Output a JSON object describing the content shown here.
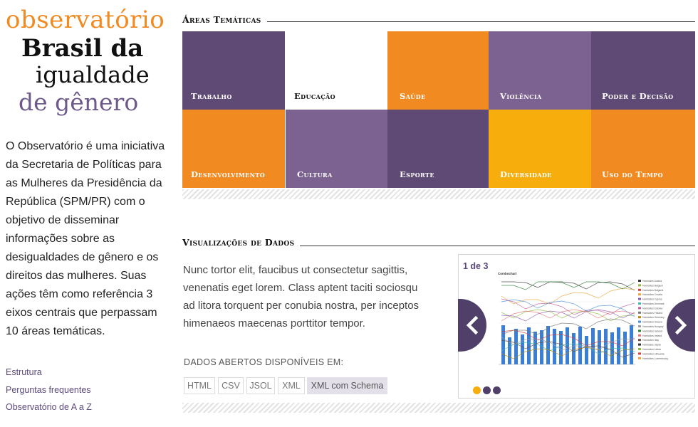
{
  "logo": {
    "line1": "observatório",
    "line2": "Brasil da",
    "line3": "igualdade",
    "line4": "de gênero"
  },
  "intro": "O Observatório é uma iniciativa da Secretaria de Políticas para as Mulheres da Presidência da República (SPM/PR) com o objetivo de disseminar informações sobre as desigualdades de gênero e os direitos das mulheres. Suas ações têm como referência 3 eixos centrais que perpassam 10 áreas temáticas.",
  "sidebar_links": [
    "Estrutura",
    "Perguntas frequentes",
    "Observatório de A a Z"
  ],
  "areas": {
    "title": "Áreas Temáticas",
    "tiles": [
      {
        "label": "Trabalho",
        "color": "#5e4a74"
      },
      {
        "label": "Educação",
        "color": "#ffffff"
      },
      {
        "label": "Saúde",
        "color": "#f28a22"
      },
      {
        "label": "Violência",
        "color": "#7c6291"
      },
      {
        "label": "Poder e Decisão",
        "color": "#5e4a74"
      },
      {
        "label": "Desenvolvimento",
        "color": "#f28a22"
      },
      {
        "label": "Cultura",
        "color": "#7c6291"
      },
      {
        "label": "Esporte",
        "color": "#5e4a74"
      },
      {
        "label": "Diversidade",
        "color": "#f7ae0c"
      },
      {
        "label": "Uso do Tempo",
        "color": "#f28a22"
      }
    ]
  },
  "viz": {
    "title": "Visualizações de Dados",
    "text": "Nunc tortor elit, faucibus ut consectetur sagittis, venenatis eget lorem. Class aptent taciti sociosqu ad litora torquent per conubia nostra, per inceptos himenaeos maecenas porttitor tempor.",
    "open_label": "DADOS ABERTOS DISPONÍVEIS EM:",
    "formats": [
      "HTML",
      "CSV",
      "JSOL",
      "XML",
      "XML com Schema"
    ],
    "active_format": "XML com Schema",
    "carousel": {
      "counter": "1 de 3",
      "dots": [
        "#f7ae0c",
        "#4f3f69",
        "#4f3f69"
      ],
      "chart_title": "Combochart",
      "legend": [
        "Homicides Austria",
        "Homicides Belgium",
        "Homicides Bulgaria",
        "Homicides Croatia",
        "Homicides Cyprus",
        "Homicides Denmark",
        "Homicides Estonia",
        "Homicides Finland",
        "Homicides Germany",
        "Homicides Greece",
        "Homicides Hungary",
        "Homicides Iceland",
        "Homicides Ireland",
        "Homicides Italy",
        "Homicides Japan",
        "Homicides Latvia",
        "Homicides Lithuania",
        "Homicides Luxembourg"
      ]
    }
  },
  "colors": {
    "orange": "#f28a22",
    "purple_dark": "#5e4a74",
    "purple": "#7c6291",
    "yellow": "#f7ae0c",
    "nav": "#4f3f69",
    "bar_blue": "#3a7fd5"
  }
}
